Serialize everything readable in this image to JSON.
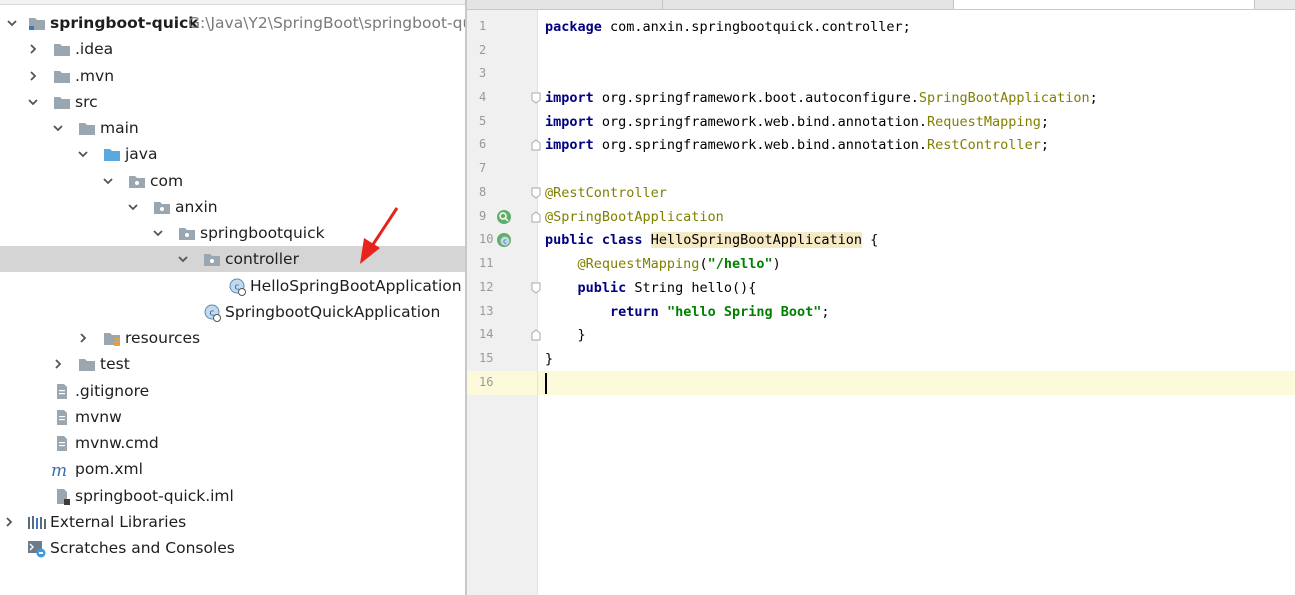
{
  "project_tree": {
    "root": {
      "name": "springboot-quick",
      "path": "G:\\Java\\Y2\\SpringBoot\\springboot-qu"
    },
    "items": [
      {
        "label": ".idea"
      },
      {
        "label": ".mvn"
      },
      {
        "label": "src"
      },
      {
        "label": "main"
      },
      {
        "label": "java"
      },
      {
        "label": "com"
      },
      {
        "label": "anxin"
      },
      {
        "label": "springbootquick"
      },
      {
        "label": "controller"
      },
      {
        "label": "HelloSpringBootApplication"
      },
      {
        "label": "SpringbootQuickApplication"
      },
      {
        "label": "resources"
      },
      {
        "label": "test"
      },
      {
        "label": ".gitignore"
      },
      {
        "label": "mvnw"
      },
      {
        "label": "mvnw.cmd"
      },
      {
        "label": "pom.xml"
      },
      {
        "label": "springboot-quick.iml"
      },
      {
        "label": "External Libraries"
      },
      {
        "label": "Scratches and Consoles"
      }
    ],
    "selected": "controller"
  },
  "editor": {
    "line_numbers": [
      "1",
      "2",
      "3",
      "4",
      "5",
      "6",
      "7",
      "8",
      "9",
      "10",
      "11",
      "12",
      "13",
      "14",
      "15",
      "16"
    ],
    "current_line": "16",
    "tokens": {
      "package_kw": "package",
      "package_name": " com.anxin.springbootquick.controller;",
      "import_kw": "import",
      "import1_pkg": " org.springframework.boot.autoconfigure.",
      "import1_cls": "SpringBootApplication",
      "import2_pkg": " org.springframework.web.bind.annotation.",
      "import2_cls": "RequestMapping",
      "import3_pkg": " org.springframework.web.bind.annotation.",
      "import3_cls": "RestController",
      "semicolon": ";",
      "ann_rest": "@RestController",
      "ann_sba": "@SpringBootApplication",
      "public_kw": "public",
      "class_kw": "class",
      "class_name": "HelloSpringBootApplication",
      "class_open": " {",
      "ann_rm": "@RequestMapping",
      "rm_open": "(",
      "rm_arg": "\"/hello\"",
      "rm_close": ")",
      "method_rest": " String hello(){",
      "return_kw": "return",
      "return_str": "\"hello Spring Boot\"",
      "close_brace": "}"
    }
  },
  "colors": {
    "keyword": "#000080",
    "annotation": "#808000",
    "string": "#008000",
    "selected_row": "#d5d5d5",
    "current_line": "#fdfadc",
    "arrow": "#e8231b"
  },
  "icons": {
    "folder": "folder-icon",
    "source_folder": "source-folder-icon",
    "package": "package-icon",
    "resources": "resources-folder-icon",
    "spring_class": "spring-boot-class-icon",
    "file": "file-icon",
    "maven": "maven-icon",
    "iml": "iml-file-icon",
    "libraries": "libraries-icon",
    "scratches": "scratches-icon"
  }
}
